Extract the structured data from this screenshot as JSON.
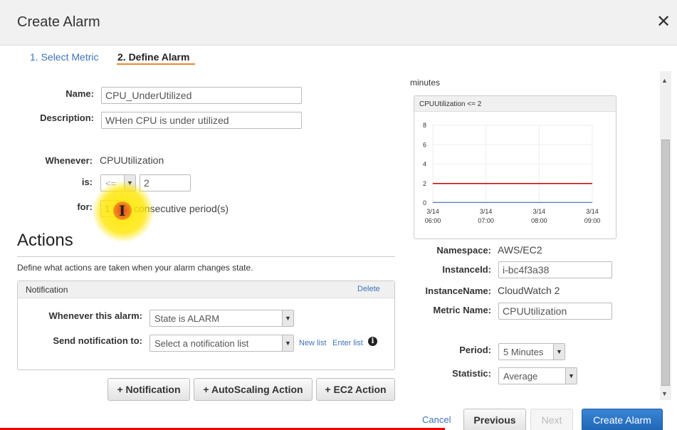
{
  "dialog": {
    "title": "Create Alarm"
  },
  "steps": [
    {
      "label": "1. Select Metric"
    },
    {
      "label": "2. Define Alarm"
    }
  ],
  "form": {
    "name_label": "Name:",
    "name_value": "CPU_UnderUtilized",
    "description_label": "Description:",
    "description_value": "WHen CPU is under utilized",
    "whenever_label": "Whenever:",
    "whenever_value": "CPUUtilization",
    "is_label": "is:",
    "operator_value": "<=",
    "threshold_value": "2",
    "for_label": "for:",
    "for_value": "1",
    "for_suffix": "consecutive period(s)"
  },
  "actions": {
    "title": "Actions",
    "description": "Define what actions are taken when your alarm changes state.",
    "notification": {
      "header": "Notification",
      "delete_label": "Delete",
      "whenever_label": "Whenever this alarm:",
      "whenever_value": "State is ALARM",
      "send_label": "Send notification to:",
      "send_placeholder": "Select a notification list",
      "new_list": "New list",
      "enter_list": "Enter list",
      "info_icon": "i"
    },
    "buttons": {
      "notification": "+ Notification",
      "autoscaling": "+ AutoScaling Action",
      "ec2": "+ EC2 Action"
    }
  },
  "preview": {
    "minutes_text": "minutes",
    "chart_title": "CPUUtilization <= 2"
  },
  "chart_data": {
    "type": "line",
    "title": "CPUUtilization <= 2",
    "x_ticks": [
      "3/14 06:00",
      "3/14 07:00",
      "3/14 08:00",
      "3/14 09:00"
    ],
    "y_ticks": [
      0,
      2,
      4,
      6,
      8
    ],
    "ylim": [
      0,
      8
    ],
    "grid": true,
    "series": [
      {
        "values": [
          0.05,
          0.05,
          0.05,
          0.05
        ],
        "color": "#3d73b9"
      },
      {
        "values": [
          2,
          2,
          2,
          2
        ],
        "color": "#cc0000"
      }
    ]
  },
  "details": {
    "namespace_label": "Namespace:",
    "namespace_value": "AWS/EC2",
    "instanceid_label": "InstanceId:",
    "instanceid_value": "i-bc4f3a38",
    "instancename_label": "InstanceName:",
    "instancename_value": "CloudWatch 2",
    "metricname_label": "Metric Name:",
    "metricname_value": "CPUUtilization",
    "period_label": "Period:",
    "period_value": "5 Minutes",
    "statistic_label": "Statistic:",
    "statistic_value": "Average"
  },
  "footer": {
    "cancel": "Cancel",
    "previous": "Previous",
    "next": "Next",
    "create": "Create Alarm"
  },
  "icons": {
    "close": "close-icon",
    "dropdown": "chevron-down-icon",
    "info": "info-icon",
    "scroll_up": "scroll-up-icon",
    "scroll_down": "scroll-down-icon"
  },
  "colors": {
    "accent": "#e8892e",
    "link": "#3d73b9",
    "primary_button": "#1f66b6",
    "threshold_line": "#cc0000"
  }
}
